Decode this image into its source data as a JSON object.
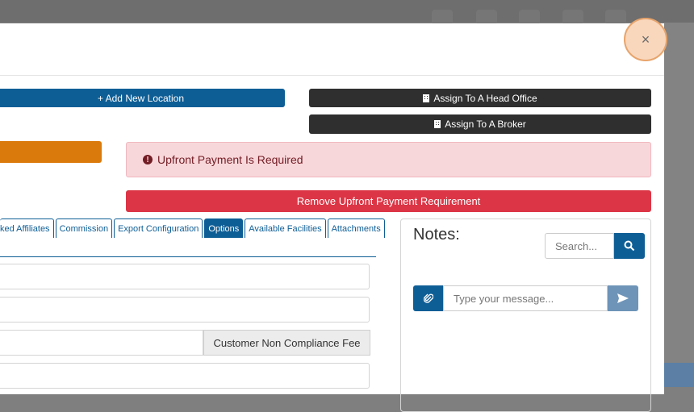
{
  "modal": {
    "close_label": "×",
    "buttons": {
      "add_location": "+ Add New Location",
      "assign_head_office": "Assign To A Head Office",
      "assign_broker": "Assign To A Broker",
      "remove_upfront": "Remove Upfront Payment Requirement"
    },
    "alert": {
      "icon": "!",
      "text": "Upfront Payment Is Required"
    },
    "tabs": [
      {
        "label": "ked Affiliates",
        "active": false
      },
      {
        "label": "Commission",
        "active": false
      },
      {
        "label": "Export Configuration",
        "active": false
      },
      {
        "label": "Options",
        "active": true
      },
      {
        "label": "Available Facilities",
        "active": false
      },
      {
        "label": "Attachments",
        "active": false
      }
    ],
    "form": {
      "fee_addon_label": "Customer Non Compliance Fee"
    },
    "notes": {
      "title": "Notes:",
      "search_placeholder": "Search...",
      "message_placeholder": "Type your message..."
    }
  },
  "colors": {
    "primary": "#0e5e96",
    "dark": "#2f2f2f",
    "warning": "#db7a0c",
    "danger": "#dc3545",
    "alert_bg": "#f8d7da"
  }
}
